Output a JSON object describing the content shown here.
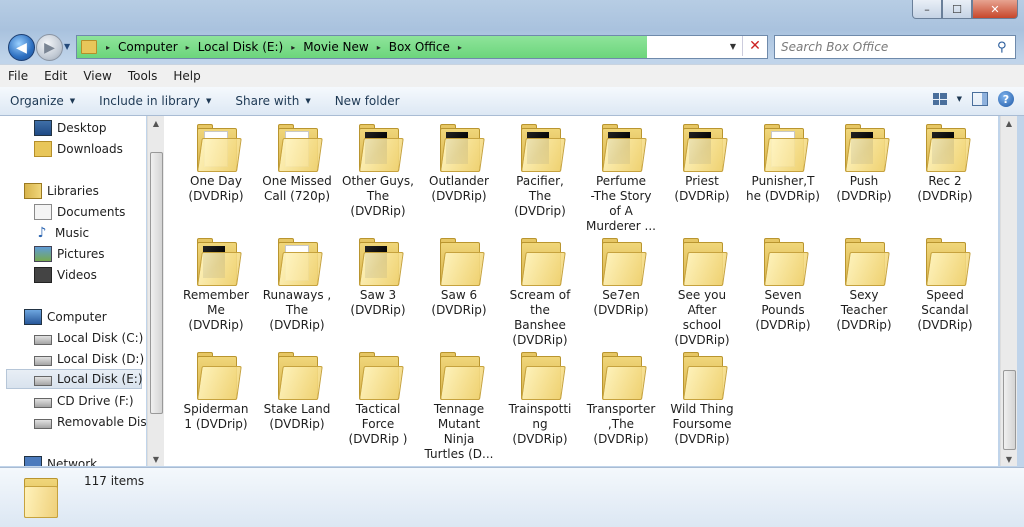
{
  "window": {
    "minimize": "–",
    "maximize": "☐",
    "close": "✕"
  },
  "address": {
    "crumbs": [
      "Computer",
      "Local Disk (E:)",
      "Movie New",
      "Box Office"
    ],
    "separator": "▸"
  },
  "search": {
    "placeholder": "Search Box Office"
  },
  "menu": [
    "File",
    "Edit",
    "View",
    "Tools",
    "Help"
  ],
  "commands": [
    "Organize",
    "Include in library",
    "Share with",
    "New folder"
  ],
  "nav": {
    "favorites": [
      {
        "label": "Desktop",
        "icon": "desktop-icon"
      },
      {
        "label": "Downloads",
        "icon": "downloads-folder-icon"
      }
    ],
    "libraries": {
      "label": "Libraries",
      "items": [
        {
          "label": "Documents"
        },
        {
          "label": "Music"
        },
        {
          "label": "Pictures"
        },
        {
          "label": "Videos"
        }
      ]
    },
    "computer": {
      "label": "Computer",
      "items": [
        {
          "label": "Local Disk (C:)"
        },
        {
          "label": "Local Disk (D:)"
        },
        {
          "label": "Local Disk (E:)",
          "selected": true
        },
        {
          "label": "CD Drive (F:)"
        },
        {
          "label": "Removable Disk ("
        }
      ]
    },
    "network": "Network"
  },
  "folders": [
    {
      "name": "One Day (DVDRip)",
      "lines": [
        "One Day",
        "(DVDRip)"
      ],
      "thumb": "paper"
    },
    {
      "name": "One Missed Call (720p)",
      "lines": [
        "One Missed",
        "Call (720p)"
      ],
      "thumb": "paper"
    },
    {
      "name": "Other Guys, The (DVDRip)",
      "lines": [
        "Other Guys,",
        "The",
        "(DVDRip)"
      ],
      "thumb": "poster"
    },
    {
      "name": "Outlander (DVDRip)",
      "lines": [
        "Outlander",
        "(DVDRip)"
      ],
      "thumb": "poster"
    },
    {
      "name": "Pacifier, The (DVDrip)",
      "lines": [
        "Pacifier,",
        "The",
        "(DVDrip)"
      ],
      "thumb": "poster"
    },
    {
      "name": "Perfume -The Story of A Murderer ...",
      "lines": [
        "Perfume",
        "-The Story",
        "of A",
        "Murderer ..."
      ],
      "thumb": "poster"
    },
    {
      "name": "Priest (DVDRip)",
      "lines": [
        "Priest",
        "(DVDRip)"
      ],
      "thumb": "poster"
    },
    {
      "name": "Punisher,The (DVDRip)",
      "lines": [
        "Punisher,T",
        "he (DVDRip)"
      ],
      "thumb": "paper"
    },
    {
      "name": "Push (DVDRip)",
      "lines": [
        "Push",
        "(DVDRip)"
      ],
      "thumb": "poster"
    },
    {
      "name": "Rec 2 (DVDRip)",
      "lines": [
        "Rec 2",
        "(DVDRip)"
      ],
      "thumb": "poster"
    },
    {
      "name": "Remember Me (DVDRip)",
      "lines": [
        "Remember",
        "Me",
        "(DVDRip)"
      ],
      "thumb": "poster"
    },
    {
      "name": "Runaways , The (DVDRip)",
      "lines": [
        "Runaways ,",
        "The",
        "(DVDRip)"
      ],
      "thumb": "paper"
    },
    {
      "name": "Saw 3 (DVDRip)",
      "lines": [
        "Saw 3",
        "(DVDRip)"
      ],
      "thumb": "poster"
    },
    {
      "name": "Saw 6 (DVDRip)",
      "lines": [
        "Saw 6",
        "(DVDRip)"
      ],
      "thumb": "none"
    },
    {
      "name": "Scream of the Banshee (DVDRip)",
      "lines": [
        "Scream of",
        "the",
        "Banshee",
        "(DVDRip)"
      ],
      "thumb": "none"
    },
    {
      "name": "Se7en (DVDRip)",
      "lines": [
        "Se7en",
        "(DVDRip)"
      ],
      "thumb": "none"
    },
    {
      "name": "See you After school (DVDRip)",
      "lines": [
        "See you",
        "After",
        "school",
        "(DVDRip)"
      ],
      "thumb": "none"
    },
    {
      "name": "Seven Pounds (DVDRip)",
      "lines": [
        "Seven",
        "Pounds",
        "(DVDRip)"
      ],
      "thumb": "none"
    },
    {
      "name": "Sexy Teacher (DVDRip)",
      "lines": [
        "Sexy",
        "Teacher",
        "(DVDRip)"
      ],
      "thumb": "none"
    },
    {
      "name": "Speed Scandal (DVDRip)",
      "lines": [
        "Speed",
        "Scandal",
        "(DVDRip)"
      ],
      "thumb": "none"
    },
    {
      "name": "Spiderman 1 (DVDrip)",
      "lines": [
        "Spiderman",
        "1  (DVDrip)"
      ],
      "thumb": "none"
    },
    {
      "name": "Stake Land (DVDRip)",
      "lines": [
        "Stake Land",
        "(DVDRip)"
      ],
      "thumb": "none"
    },
    {
      "name": "Tactical Force (DVDRip )",
      "lines": [
        "Tactical",
        "Force",
        "(DVDRip )"
      ],
      "thumb": "none"
    },
    {
      "name": "Tennage Mutant Ninja Turtles (D...",
      "lines": [
        "Tennage",
        "Mutant",
        "Ninja",
        "Turtles (D..."
      ],
      "thumb": "none"
    },
    {
      "name": "Trainspotting (DVDRip)",
      "lines": [
        "Trainspotti",
        "ng",
        "(DVDRip)"
      ],
      "thumb": "none"
    },
    {
      "name": "Transporter ,The (DVDRip)",
      "lines": [
        "Transporter",
        ",The",
        "(DVDRip)"
      ],
      "thumb": "none"
    },
    {
      "name": "Wild Thing Foursome (DVDRip)",
      "lines": [
        "Wild Thing",
        "Foursome",
        "(DVDRip)"
      ],
      "thumb": "none"
    }
  ],
  "status": {
    "count": "117 items"
  },
  "colors": {
    "address_progress": "#6cd57c",
    "folder": "#f0d67a",
    "selection": "#d9e3ee"
  }
}
